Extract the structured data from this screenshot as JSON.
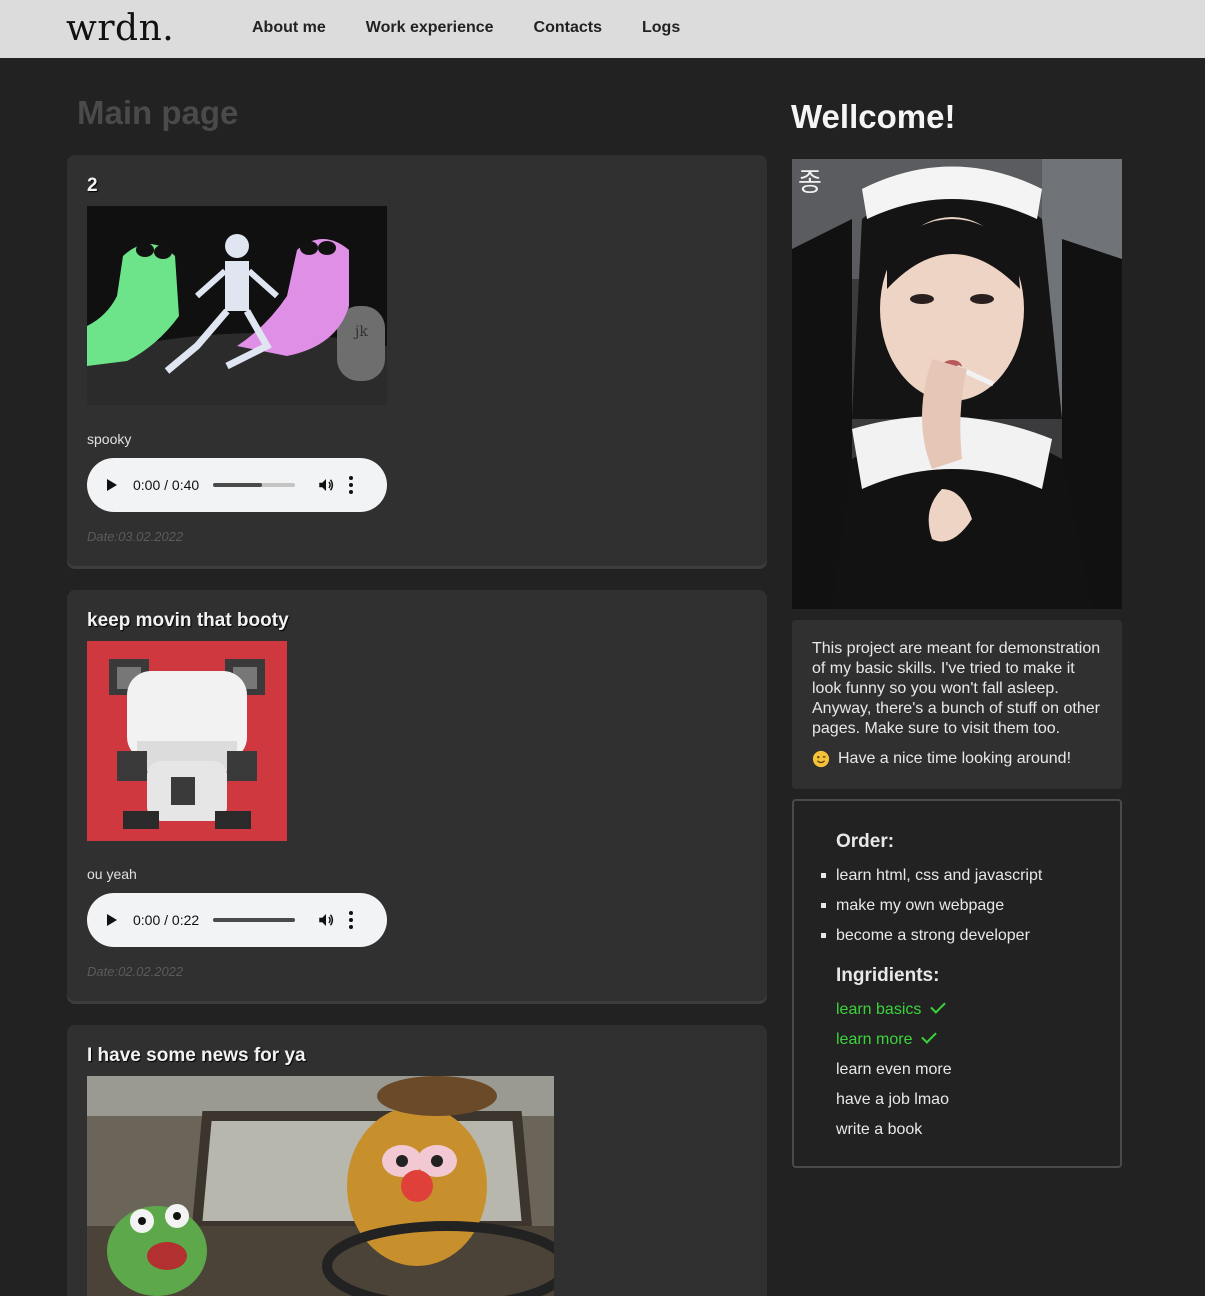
{
  "header": {
    "logo": "wrdn.",
    "nav": [
      "About me",
      "Work experience",
      "Contacts",
      "Logs"
    ]
  },
  "main": {
    "title": "Main page",
    "posts": [
      {
        "title": "2",
        "caption": "spooky",
        "audio_time": "0:00 / 0:40",
        "audio_progress": 0.6,
        "date": "Date:03.02.2022",
        "image": "dancing-skeleton-ghosts-gif"
      },
      {
        "title": "keep movin that booty",
        "caption": "ou yeah",
        "audio_time": "0:00 / 0:22",
        "audio_progress": 1.0,
        "date": "Date:02.02.2022",
        "image": "pixel-panda-gif"
      },
      {
        "title": "I have some news for ya",
        "image": "muppets-car-gif"
      }
    ]
  },
  "sidebar": {
    "welcome": "Wellcome!",
    "hero_image": "maid-streamer-gif",
    "hero_overlay_text": "종",
    "about_text": "This project are meant for demonstration of my basic skills. I've tried to make it look funny so you won't fall asleep. Anyway, there's a bunch of stuff on other pages. Make sure to visit them too.",
    "about_nice": "Have a nice time looking around!",
    "order": {
      "title": "Order:",
      "items": [
        "learn html, css and javascript",
        "make my own webpage",
        "become a strong developer"
      ]
    },
    "ingredients": {
      "title": "Ingridients:",
      "items": [
        {
          "label": "learn basics",
          "done": true
        },
        {
          "label": "learn more",
          "done": true
        },
        {
          "label": "learn even more",
          "done": false
        },
        {
          "label": "have a job lmao",
          "done": false
        },
        {
          "label": "write a book",
          "done": false
        }
      ]
    }
  },
  "colors": {
    "done": "#3bd43b",
    "card": "#303030",
    "background": "#222222",
    "header": "#dcdcdc"
  }
}
